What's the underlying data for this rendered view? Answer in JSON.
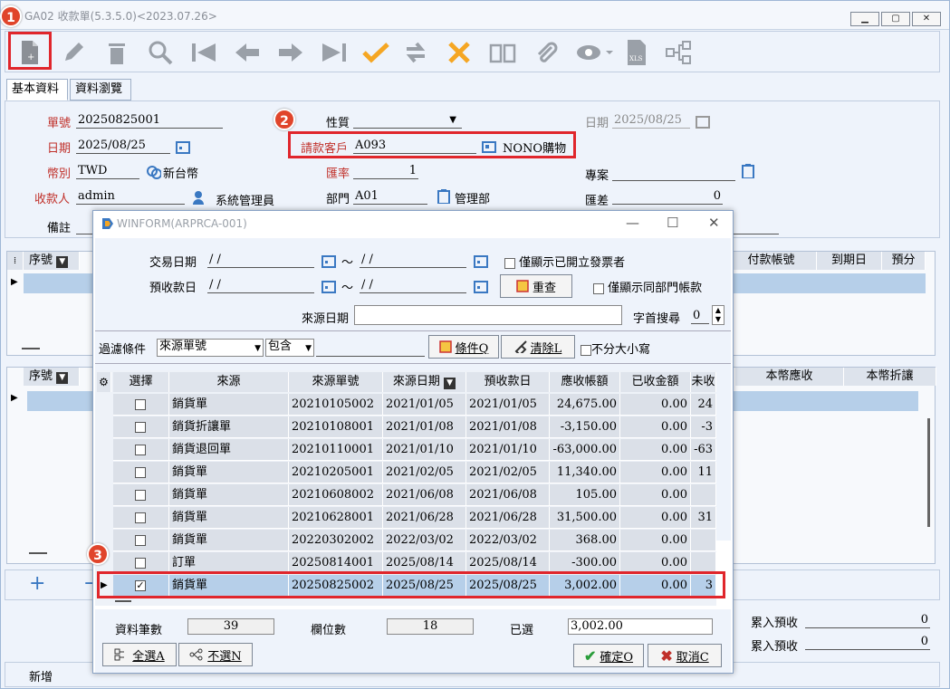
{
  "window": {
    "title": "GA02 收款單(5.3.5.0)<2023.07.26>"
  },
  "tabs": [
    "基本資料",
    "資料瀏覽"
  ],
  "form": {
    "doc_no_label": "單號",
    "doc_no": "20250825001",
    "date_label": "日期",
    "date": "2025/08/25",
    "currency_label": "幣別",
    "currency": "TWD",
    "currency_name": "新台幣",
    "payee_label": "收款人",
    "payee": "admin",
    "payee_name": "系統管理員",
    "note_label": "備註",
    "nature_label": "性質",
    "customer_label": "請款客戶",
    "customer": "A093",
    "customer_name": "NONO購物",
    "rate_label": "匯率",
    "rate": "1",
    "dept_label": "部門",
    "dept": "A01",
    "dept_name": "管理部",
    "date2_label": "日期",
    "date2": "2025/08/25",
    "project_label": "專案",
    "diff_label": "匯差",
    "diff": "0"
  },
  "main_grid1": {
    "seq": "序號",
    "cols": [
      "付款帳號",
      "到期日",
      "預分"
    ]
  },
  "main_grid2": {
    "seq": "序號",
    "cols": [
      "本幣應收",
      "本幣折讓"
    ]
  },
  "right_totals": {
    "label1": "累入預收",
    "value1": "0",
    "label2": "累入預收",
    "value2": "0"
  },
  "status": {
    "left": "新增"
  },
  "markers": [
    "1",
    "2",
    "3"
  ],
  "dialog": {
    "title": "WINFORM(ARPRCA-001)",
    "trade_date_label": "交易日期",
    "trade_from": " / /",
    "trade_to": " / /",
    "prepay_date_label": "預收款日",
    "prepay_from": " / /",
    "prepay_to": " / /",
    "tilde": "～",
    "only_invoiced": "僅顯示已開立發票者",
    "only_same_dept": "僅顯示同部門帳款",
    "requery": "重查",
    "source_date_label": "來源日期",
    "prefix_search_label": "字首搜尋",
    "prefix_search_value": "0",
    "filter_label": "過濾條件",
    "filter_field": "來源單號",
    "filter_op": "包含",
    "condition_btn": "條件Q",
    "clear_btn": "清除L",
    "case_insensitive": "不分大小寫",
    "columns": [
      "選擇",
      "來源",
      "來源單號",
      "來源日期",
      "預收款日",
      "應收帳額",
      "已收金額",
      "未收"
    ],
    "rows": [
      {
        "checked": false,
        "source": "銷貨單",
        "no": "20210105002",
        "date": "2021/01/05",
        "prepay": "2021/01/05",
        "amount": "24,675.00",
        "received": "0.00",
        "unpaid": "24"
      },
      {
        "checked": false,
        "source": "銷貨折讓單",
        "no": "20210108001",
        "date": "2021/01/08",
        "prepay": "2021/01/08",
        "amount": "-3,150.00",
        "received": "0.00",
        "unpaid": "-3"
      },
      {
        "checked": false,
        "source": "銷貨退回單",
        "no": "20210110001",
        "date": "2021/01/10",
        "prepay": "2021/01/10",
        "amount": "-63,000.00",
        "received": "0.00",
        "unpaid": "-63"
      },
      {
        "checked": false,
        "source": "銷貨單",
        "no": "20210205001",
        "date": "2021/02/05",
        "prepay": "2021/02/05",
        "amount": "11,340.00",
        "received": "0.00",
        "unpaid": "11"
      },
      {
        "checked": false,
        "source": "銷貨單",
        "no": "20210608002",
        "date": "2021/06/08",
        "prepay": "2021/06/08",
        "amount": "105.00",
        "received": "0.00",
        "unpaid": ""
      },
      {
        "checked": false,
        "source": "銷貨單",
        "no": "20210628001",
        "date": "2021/06/28",
        "prepay": "2021/06/28",
        "amount": "31,500.00",
        "received": "0.00",
        "unpaid": "31"
      },
      {
        "checked": false,
        "source": "銷貨單",
        "no": "20220302002",
        "date": "2022/03/02",
        "prepay": "2022/03/02",
        "amount": "368.00",
        "received": "0.00",
        "unpaid": ""
      },
      {
        "checked": false,
        "source": "訂單",
        "no": "20250814001",
        "date": "2025/08/14",
        "prepay": "2025/08/14",
        "amount": "-300.00",
        "received": "0.00",
        "unpaid": ""
      },
      {
        "checked": true,
        "source": "銷貨單",
        "no": "20250825002",
        "date": "2025/08/25",
        "prepay": "2025/08/25",
        "amount": "3,002.00",
        "received": "0.00",
        "unpaid": "3"
      }
    ],
    "record_count_label": "資料筆數",
    "record_count": "39",
    "field_count_label": "欄位數",
    "field_count": "18",
    "selected_label": "已選",
    "selected_value": "3,002.00",
    "select_all": "全選A",
    "deselect": "不選N",
    "ok": "確定O",
    "cancel": "取消C"
  },
  "colors": {
    "accent_red": "#e0262c",
    "marker": "#e0452b",
    "header": "#dde3ec",
    "selected_row": "#b6cfe9"
  }
}
